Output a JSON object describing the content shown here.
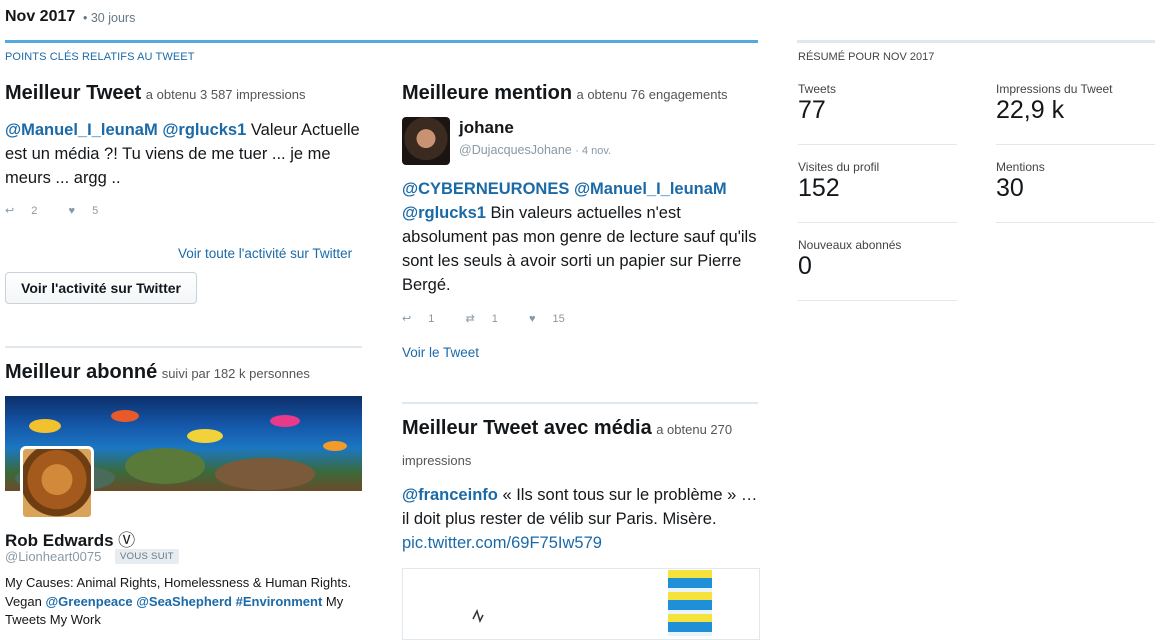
{
  "header": {
    "month": "Nov 2017",
    "period": "• 30 jours"
  },
  "highlights": {
    "label": "POINTS CLÉS RELATIFS AU TWEET"
  },
  "top_tweet": {
    "title": "Meilleur Tweet",
    "subtitle": "a obtenu 3 587 impressions",
    "mentions": [
      "@Manuel_I_leunaM",
      "@rglucks1"
    ],
    "text_line1_rest": " Valeur",
    "text_rest": "Actuelle est un média ?! Tu viens de me tuer ... je me meurs ... argg ..",
    "replies": "2",
    "likes": "5",
    "link": "Voir toute l'activité sur Twitter",
    "button": "Voir l'activité sur Twitter"
  },
  "top_mention": {
    "title": "Meilleure mention",
    "subtitle": "a obtenu 76 engagements",
    "user_name": "johane",
    "user_handle": "@DujacquesJohane",
    "date": "· 4 nov.",
    "mention1": "@CYBERNEURONES",
    "mention2": "@Manuel_I_leunaM",
    "mention3": "@rglucks1",
    "text_rest": " Bin valeurs actuelles n'est absolument pas mon genre de lecture sauf qu'ils sont les seuls à avoir sorti un papier sur Pierre Bergé.",
    "replies": "1",
    "retweets": "1",
    "likes": "15",
    "link": "Voir le Tweet"
  },
  "top_follower": {
    "title": "Meilleur abonné",
    "subtitle": "suivi par 182 k personnes",
    "name": "Rob Edwards",
    "verified_glyph": "Ⓥ",
    "handle": "@Lionheart0075",
    "badge": "VOUS SUIT",
    "bio_a": "My Causes: Animal Rights, Homelessness & Human Rights. Vegan ",
    "bio_m1": "@Greenpeace",
    "bio_m2": "@SeaShepherd",
    "bio_m3": "#Environment",
    "bio_b": " My Tweets My Work"
  },
  "top_media_tweet": {
    "title": "Meilleur Tweet avec média",
    "subtitle_a": "a obtenu 270",
    "subtitle_b": "impressions",
    "mention": "@franceinfo",
    "text_rest": " « Ils sont tous sur le problème » … il doit plus rester de vélib sur Paris. Misère. ",
    "pic_link": "pic.twitter.com/69F75Iw579"
  },
  "summary": {
    "label": "RÉSUMÉ POUR NOV 2017",
    "items": [
      {
        "label": "Tweets",
        "value": "77"
      },
      {
        "label": "Impressions du Tweet",
        "value": "22,9 k"
      },
      {
        "label": "Visites du profil",
        "value": "152"
      },
      {
        "label": "Mentions",
        "value": "30"
      },
      {
        "label": "Nouveaux abonnés",
        "value": "0"
      }
    ]
  },
  "colors": {
    "accent": "#55a8e0",
    "link": "#1b6aa8"
  },
  "icons": [
    "reply-icon",
    "retweet-icon",
    "heart-icon",
    "verified-icon"
  ]
}
